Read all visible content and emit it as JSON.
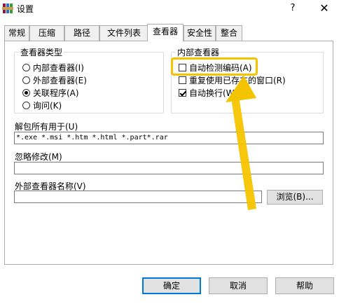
{
  "window": {
    "title": "设置",
    "help_label": "?",
    "close_label": "✕",
    "app_icon": "winrar-icon"
  },
  "tabs": [
    {
      "label": "常规",
      "active": false
    },
    {
      "label": "压缩",
      "active": false
    },
    {
      "label": "路径",
      "active": false
    },
    {
      "label": "文件列表",
      "active": false
    },
    {
      "label": "查看器",
      "active": true
    },
    {
      "label": "安全性",
      "active": false
    },
    {
      "label": "整合",
      "active": false
    }
  ],
  "viewer_type": {
    "legend": "查看器类型",
    "options": [
      {
        "label": "内部查看器(I)",
        "checked": false
      },
      {
        "label": "外部查看器(E)",
        "checked": false
      },
      {
        "label": "关联程序(A)",
        "checked": true
      },
      {
        "label": "询问(K)",
        "checked": false
      }
    ]
  },
  "internal_viewer": {
    "legend": "内部查看器",
    "options": [
      {
        "label": "自动检测编码(A)",
        "checked": false
      },
      {
        "label": "重复使用已存在的窗口(R)",
        "checked": false
      },
      {
        "label": "自动换行(W)",
        "checked": true
      }
    ]
  },
  "fields": {
    "unpack_label": "解包所有用于(U)",
    "unpack_value": "*.exe *.msi *.htm *.html *.part*.rar",
    "ignore_label": "忽略修改(M)",
    "ignore_value": "",
    "external_label": "外部查看器名称(V)",
    "external_value": "",
    "browse_label": "浏览(B)..."
  },
  "buttons": {
    "ok": "确定",
    "cancel": "取消",
    "help": "帮助"
  },
  "annotation": {
    "highlight_color": "#f5c400",
    "arrow_color": "#f5c400"
  }
}
